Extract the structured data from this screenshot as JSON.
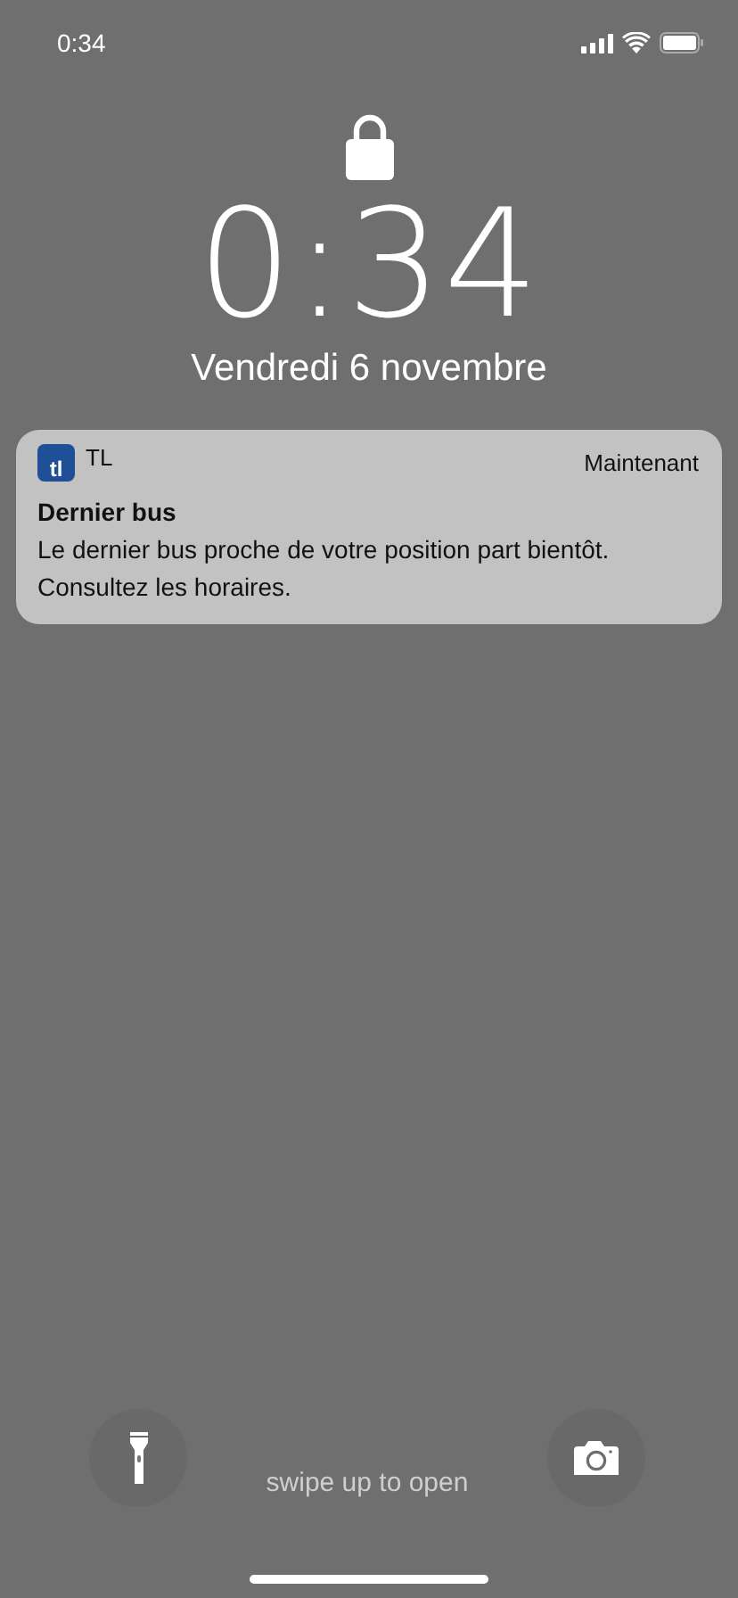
{
  "status_bar": {
    "time": "0:34"
  },
  "clock": {
    "time": "0:34",
    "date": "Vendredi 6 novembre"
  },
  "notification": {
    "app_logo": "tl",
    "app": "TL",
    "time": "Maintenant",
    "title": "Dernier bus",
    "body": "Le dernier bus proche de votre position part bientôt. Consultez les horaires."
  },
  "bottom": {
    "hint": "swipe up to open"
  }
}
